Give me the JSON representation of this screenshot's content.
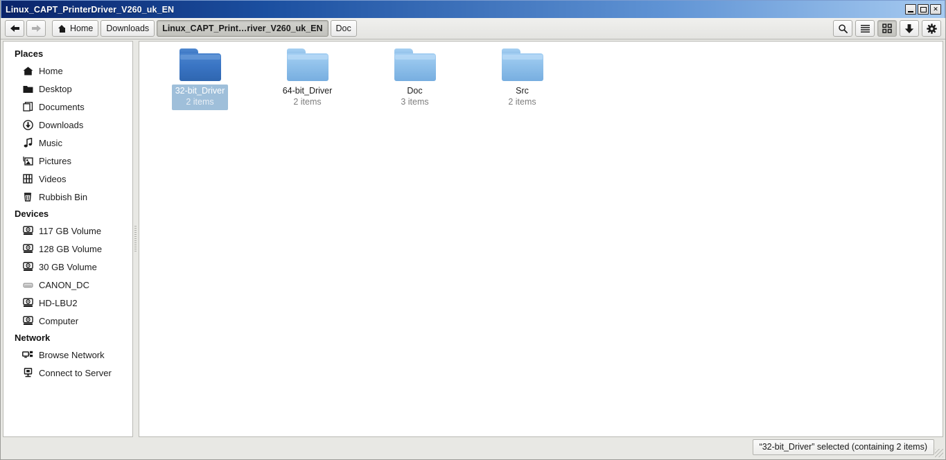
{
  "window": {
    "title": "Linux_CAPT_PrinterDriver_V260_uk_EN",
    "controls": {
      "minimize": "minimize-button",
      "maximize": "maximize-button",
      "close": "✕"
    }
  },
  "toolbar": {
    "back": {
      "label": "",
      "icon": "arrow-left-icon",
      "enabled": true
    },
    "forward": {
      "label": "",
      "icon": "arrow-right-icon",
      "enabled": false
    },
    "breadcrumbs": [
      {
        "label": "Home",
        "icon": "home-icon",
        "active": false
      },
      {
        "label": "Downloads",
        "icon": "",
        "active": false
      },
      {
        "label": "Linux_CAPT_Print…river_V260_uk_EN",
        "icon": "",
        "active": true
      },
      {
        "label": "Doc",
        "icon": "",
        "active": false
      }
    ],
    "right_buttons": [
      {
        "name": "search-icon",
        "pressed": false
      },
      {
        "name": "list-view-icon",
        "pressed": false
      },
      {
        "name": "icon-view-icon",
        "pressed": true
      },
      {
        "name": "download-icon",
        "pressed": false
      },
      {
        "name": "gear-icon",
        "pressed": false
      }
    ]
  },
  "sidebar": {
    "sections": [
      {
        "header": "Places",
        "items": [
          {
            "label": "Home",
            "icon": "home-icon"
          },
          {
            "label": "Desktop",
            "icon": "folder-icon"
          },
          {
            "label": "Documents",
            "icon": "documents-icon"
          },
          {
            "label": "Downloads",
            "icon": "download-circle-icon"
          },
          {
            "label": "Music",
            "icon": "music-note-icon"
          },
          {
            "label": "Pictures",
            "icon": "pictures-icon"
          },
          {
            "label": "Videos",
            "icon": "film-icon"
          },
          {
            "label": "Rubbish Bin",
            "icon": "trash-icon"
          }
        ]
      },
      {
        "header": "Devices",
        "items": [
          {
            "label": "117 GB Volume",
            "icon": "drive-icon"
          },
          {
            "label": "128 GB Volume",
            "icon": "drive-icon"
          },
          {
            "label": "30 GB Volume",
            "icon": "drive-icon"
          },
          {
            "label": "CANON_DC",
            "icon": "removable-drive-icon"
          },
          {
            "label": "HD-LBU2",
            "icon": "drive-icon"
          },
          {
            "label": "Computer",
            "icon": "drive-icon"
          }
        ]
      },
      {
        "header": "Network",
        "items": [
          {
            "label": "Browse Network",
            "icon": "network-icon"
          },
          {
            "label": "Connect to Server",
            "icon": "server-icon"
          }
        ]
      }
    ]
  },
  "content": {
    "files": [
      {
        "name": "32-bit_Driver",
        "count": "2 items",
        "selected": true
      },
      {
        "name": "64-bit_Driver",
        "count": "2 items",
        "selected": false
      },
      {
        "name": "Doc",
        "count": "3 items",
        "selected": false
      },
      {
        "name": "Src",
        "count": "2 items",
        "selected": false
      }
    ]
  },
  "statusbar": {
    "text": "“32-bit_Driver” selected (containing 2 items)"
  },
  "colors": {
    "title_left": "#0a246a",
    "title_right": "#a6caf0",
    "folder_selected": "#3a75c4",
    "folder_normal": "#8fc0ea",
    "selection_bg": "#9fbfda",
    "toolbar_bg": "#e8e8e4"
  }
}
